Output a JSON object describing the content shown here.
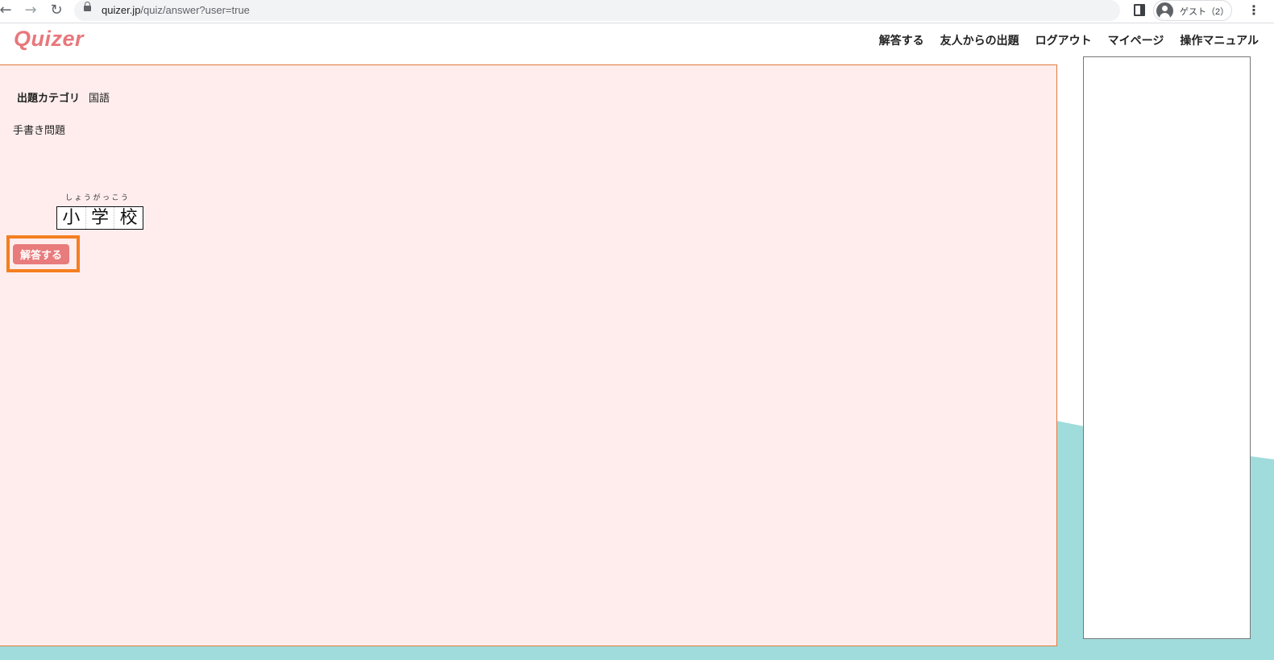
{
  "browser": {
    "url_host": "quizer.jp",
    "url_path": "/quiz/answer?user=true",
    "profile_label": "ゲスト（2）",
    "back_icon": "arrow-left-icon",
    "forward_icon": "arrow-right-icon",
    "reload_icon": "reload-icon"
  },
  "site": {
    "logo": "Quizer",
    "brand_color": "#e8777b",
    "nav": [
      "解答する",
      "友人からの出題",
      "ログアウト",
      "マイページ",
      "操作マニュアル"
    ]
  },
  "quiz": {
    "category_label": "出題カテゴリ",
    "category_value": "国語",
    "question_type": "手書き問題",
    "furigana": "しょうがっこう",
    "handwritten_chars": [
      "小",
      "学",
      "校"
    ],
    "answer_button": "解答する",
    "highlight_color": "#f47f20"
  },
  "colors": {
    "card_bg": "#ffeded",
    "card_border": "#e07a3e",
    "wave": "#a0dcdc",
    "button": "#e87b7b"
  }
}
